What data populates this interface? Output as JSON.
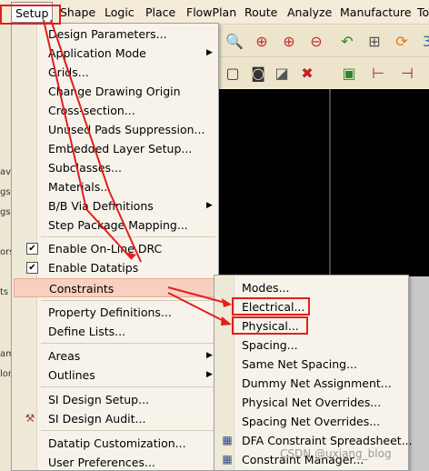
{
  "menubar": {
    "items": [
      "Setup",
      "Shape",
      "Logic",
      "Place",
      "FlowPlan",
      "Route",
      "Analyze",
      "Manufacture",
      "To"
    ]
  },
  "left_fragments": [
    "avi",
    "gs",
    "gs",
    "ors",
    "ts",
    "am",
    "lor"
  ],
  "setup_menu": {
    "items": [
      {
        "label": "Design Parameters...",
        "has_submenu": false
      },
      {
        "label": "Application Mode",
        "has_submenu": true
      },
      {
        "label": "Grids...",
        "has_submenu": false
      },
      {
        "label": "Change Drawing Origin",
        "has_submenu": false
      },
      {
        "label": "Cross-section...",
        "has_submenu": false
      },
      {
        "label": "Unused Pads Suppression...",
        "has_submenu": false
      },
      {
        "label": "Embedded Layer Setup...",
        "has_submenu": false
      },
      {
        "label": "Subclasses...",
        "has_submenu": false
      },
      {
        "label": "Materials...",
        "has_submenu": false
      },
      {
        "label": "B/B Via Definitions",
        "has_submenu": true
      },
      {
        "label": "Step Package Mapping...",
        "has_submenu": false
      },
      {
        "label": "Enable On-Line DRC",
        "has_submenu": false,
        "checked": true
      },
      {
        "label": "Enable Datatips",
        "has_submenu": false,
        "checked": true
      },
      {
        "label": "Constraints",
        "has_submenu": true,
        "highlighted": true
      },
      {
        "label": "Property Definitions...",
        "has_submenu": false
      },
      {
        "label": "Define Lists...",
        "has_submenu": false
      },
      {
        "label": "Areas",
        "has_submenu": true
      },
      {
        "label": "Outlines",
        "has_submenu": true
      },
      {
        "label": "SI Design Setup...",
        "has_submenu": false
      },
      {
        "label": "SI Design Audit...",
        "has_submenu": false
      },
      {
        "label": "Datatip Customization...",
        "has_submenu": false
      },
      {
        "label": "User Preferences...",
        "has_submenu": false
      }
    ]
  },
  "constraints_submenu": {
    "items": [
      "Modes...",
      "Electrical...",
      "Physical...",
      "Spacing...",
      "Same Net Spacing...",
      "Dummy Net Assignment...",
      "Physical Net Overrides...",
      "Spacing Net Overrides...",
      "DFA Constraint Spreadsheet...",
      "Constraint Manager..."
    ]
  },
  "watermark": "CSDN @uxiang_blog",
  "colors": {
    "menu_bg": "#f7f3ea",
    "highlight": "#f8d0c0",
    "annotation_red": "#e02020",
    "canvas": "#000000"
  }
}
